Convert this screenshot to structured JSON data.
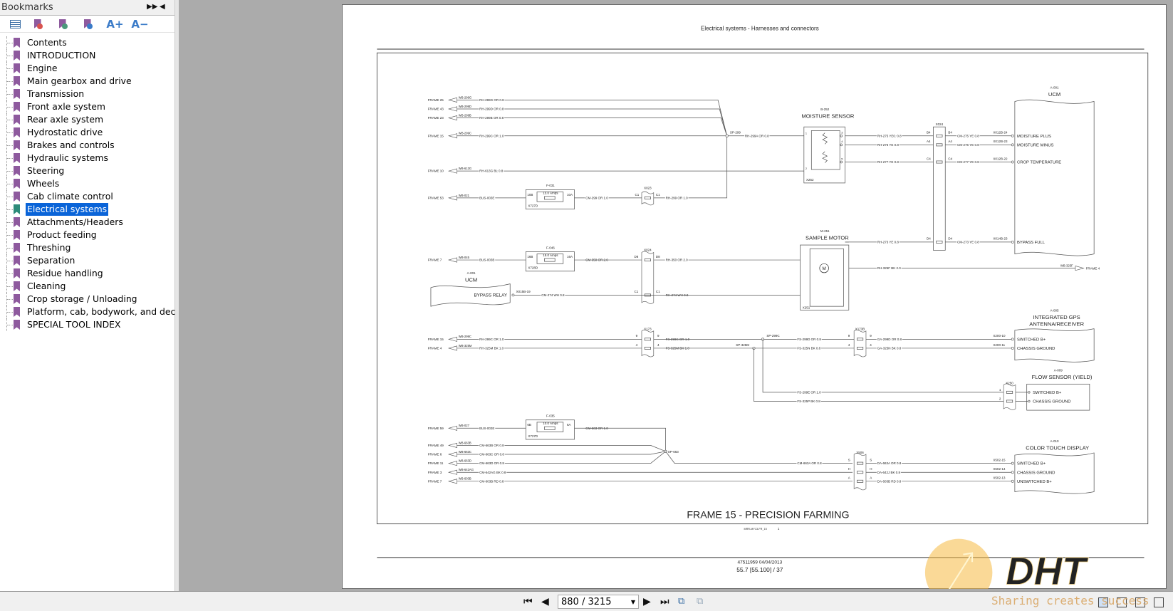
{
  "sidebar": {
    "title": "Bookmarks",
    "tools": [
      {
        "icon": "bookmark-list-icon"
      },
      {
        "icon": "delete-bookmark-icon"
      },
      {
        "icon": "add-bookmark-icon"
      },
      {
        "icon": "go-to-bookmark-icon"
      },
      {
        "icon": "increase-font-icon",
        "label": "A+"
      },
      {
        "icon": "decrease-font-icon",
        "label": "A−"
      }
    ],
    "items": [
      {
        "label": "Contents"
      },
      {
        "label": "INTRODUCTION"
      },
      {
        "label": "Engine"
      },
      {
        "label": "Main gearbox and drive"
      },
      {
        "label": "Transmission"
      },
      {
        "label": "Front axle system"
      },
      {
        "label": "Rear axle system"
      },
      {
        "label": "Hydrostatic drive"
      },
      {
        "label": "Brakes and controls"
      },
      {
        "label": "Hydraulic systems"
      },
      {
        "label": "Steering"
      },
      {
        "label": "Wheels"
      },
      {
        "label": "Cab climate control"
      },
      {
        "label": "Electrical systems",
        "selected": true
      },
      {
        "label": "Attachments/Headers"
      },
      {
        "label": "Product feeding"
      },
      {
        "label": "Threshing"
      },
      {
        "label": "Separation"
      },
      {
        "label": "Residue handling"
      },
      {
        "label": "Cleaning"
      },
      {
        "label": "Crop storage / Unloading"
      },
      {
        "label": "Platform, cab, bodywork, and decals"
      },
      {
        "label": "SPECIAL TOOL INDEX"
      }
    ],
    "colors": {
      "bookmark": "#8e5a9e",
      "bookmark_selected": "#2e8b7a",
      "selection": "#0a64d8"
    }
  },
  "page": {
    "header": "Electrical systems - Harnesses and connectors",
    "frame_title": "FRAME 15 - PRECISION FARMING",
    "drawing_code": "MRR-MY13-FR_15",
    "drawing_sheet": "1",
    "doc_id": "47511959 04/04/2013",
    "page_ref": "55.7 [55.100] / 37"
  },
  "diagram": {
    "harness_rows": [
      {
        "frame": "FRAME 25",
        "tag": "WB-299G",
        "wire": "RH-299G OR 0.8"
      },
      {
        "frame": "FRAME 43",
        "tag": "WB-299D",
        "wire": "RH-299D OR 0.8"
      },
      {
        "frame": "FRAME 23",
        "tag": "WB-299B",
        "wire": "RH-299B OR 0.8"
      },
      {
        "frame": "FRAME 15",
        "tag": "WB-299C",
        "wire": "RH-299C OR 1.0"
      },
      {
        "frame": "FRAME 10",
        "tag": "WB-613G",
        "wire": "RH-613G BL 0.8"
      },
      {
        "frame": "FRAME 53",
        "tag": "WB-021",
        "wire": "BUS-003E"
      },
      {
        "frame": "FRAME 7",
        "tag": "WB-045",
        "wire": "BUS-003B"
      },
      {
        "frame": "FRAME 15",
        "tag": "WB-299C",
        "wire": "RH-299C OR 1.0"
      },
      {
        "frame": "FRAME 4",
        "tag": "WB-325M",
        "wire": "RH-325M BK 1.0"
      },
      {
        "frame": "FRAME 59",
        "tag": "WB-027",
        "wire": "BUS-003E"
      },
      {
        "frame": "FRAME 49",
        "tag": "WB-663B",
        "wire": "CM-663B OR 0.8"
      },
      {
        "frame": "FRAME 6",
        "tag": "WB-663C",
        "wire": "CM-663C OR 0.8"
      },
      {
        "frame": "FRAME 11",
        "tag": "WB-663D",
        "wire": "CM-663D OR 0.8"
      },
      {
        "frame": "FRAME 3",
        "tag": "WB-642AG",
        "wire": "CM-642AG BK 0.8"
      },
      {
        "frame": "FRAME 7",
        "tag": "WB-603B",
        "wire": "CM-603B RD 0.8"
      }
    ],
    "fuses": [
      {
        "id": "F-031",
        "rating": "15.0 Amps",
        "pin_in": "10B",
        "pin_out": "10A",
        "connector": "X727D",
        "out_wire": "CM-299 OR 1.0"
      },
      {
        "id": "F-046",
        "rating": "15.0 Amps",
        "pin_in": "16B",
        "pin_out": "16A",
        "connector": "X728D",
        "out_wire": "CM-350 OR 2.0"
      },
      {
        "id": "F-035",
        "rating": "10.0 Amps",
        "pin_in": "6B",
        "pin_out": "6A",
        "connector": "X727D",
        "out_wire": "CM-663 OR 1.0"
      }
    ],
    "splices": {
      "sp299": "SP-299",
      "sp299c": "SP-299C",
      "sp325m": "SP-325M",
      "sp663": "SP-663"
    },
    "x023": {
      "id": "X023",
      "pin": "C1",
      "wire": "RH-299 OR 1.0"
    },
    "moisture_sensor": {
      "ref": "B-252",
      "name": "MOISTURE SENSOR",
      "connector": "X252",
      "in_wire": "RH-299A OR 0.8",
      "pins": [
        "1",
        "2",
        "3",
        "4",
        "5"
      ]
    },
    "sample_motor": {
      "ref": "M-251",
      "name": "SAMPLE MOTOR",
      "connector": "X251",
      "motor": "M",
      "ground_wire": "RH-325F BK 2.0",
      "ground_tag": "WB-325F",
      "ground_frame": "FRAME 4"
    },
    "x024": {
      "id": "X024",
      "rows": [
        {
          "pin": "B4",
          "left": "RH-275 YE0. 0.8",
          "right": "CM-275 YE 0.8",
          "ucm_pin": "X012B-24",
          "signal": "MOISTURE PLUS"
        },
        {
          "pin": "A4",
          "left": "RH-276 YE 0.8",
          "right": "CM-276 YE 0.8",
          "ucm_pin": "X012B-23",
          "signal": "MOISTURE MINUS"
        },
        {
          "pin": "C4",
          "left": "RH-277 YE 0.8",
          "right": "CM-277 YE 0.8",
          "ucm_pin": "X012B-22",
          "signal": "CROP TEMPERATURE"
        },
        {
          "pin": "D4",
          "left": "RH-273 YE 0.8",
          "right": "CM-273 YE 0.8",
          "ucm_pin": "X014B-23",
          "signal": "BYPASS FULL"
        }
      ],
      "left_rows": [
        {
          "pin": "D8",
          "wire": "RH-350 OR 2.0"
        },
        {
          "pin": "C1",
          "wire": "RH-274 WH 0.8",
          "in_wire": "CM-274 WH 0.8"
        }
      ]
    },
    "ucm": {
      "ref": "A-001",
      "name": "UCM",
      "relay_label": "BYPASS RELAY",
      "relay_pin": "X015B-19"
    },
    "x173": {
      "id": "X173",
      "pins": [
        "9",
        "4"
      ],
      "wires": [
        "FS-299C OR 1.0",
        "FS-325M BK 1.0"
      ]
    },
    "x173b": {
      "id": "X173B",
      "pins": [
        "9",
        "4"
      ],
      "left": [
        "FS-299D OR 0.8",
        "FS-325N BK 0.8"
      ],
      "right": [
        "GA-299D OR 0.8",
        "GA-325N BK 0.8"
      ]
    },
    "gps": {
      "ref": "A-005",
      "name_line1": "INTEGRATED GPS",
      "name_line2": "ANTENNA/RECEIVER",
      "pins": [
        "X200-10",
        "X200-11"
      ],
      "signals": [
        "SWITCHED B+",
        "CHASSIS GROUND"
      ]
    },
    "flow_sensor": {
      "ref": "A-009",
      "name": "FLOW SENSOR (YIELD)",
      "connector": "X250",
      "pins": [
        "1",
        "2"
      ],
      "wires": [
        "FS-299E OR 1.0",
        "FS-325P BK 0.8"
      ],
      "signals": [
        "SWITCHED B+",
        "CHASSIS GROUND"
      ]
    },
    "display": {
      "ref": "A-010",
      "name": "COLOR TOUCH DISPLAY",
      "connector": "X506",
      "in_wire": "CM-663A OR 0.8",
      "pins": [
        "S",
        "H",
        "A"
      ],
      "wires": [
        "DA-663A OR 0.8",
        "DA-642J BK 0.8",
        "DA-603B RD 0.8"
      ],
      "ucm_pins": [
        "X502-15",
        "X502-14",
        "X502-13"
      ],
      "signals": [
        "SWITCHED B+",
        "CHASSIS GROUND",
        "UNSWITCHED B+"
      ]
    }
  },
  "toolbar": {
    "page_field": "880 / 3215",
    "buttons": [
      "first-page",
      "previous-page",
      "next-page",
      "last-page",
      "previous-view",
      "next-view"
    ],
    "view_modes": [
      "single-page",
      "continuous",
      "facing",
      "continuous-facing"
    ]
  },
  "watermark": {
    "logo": "DHT",
    "tagline": "Sharing creates success",
    "color": "#f5b942"
  }
}
